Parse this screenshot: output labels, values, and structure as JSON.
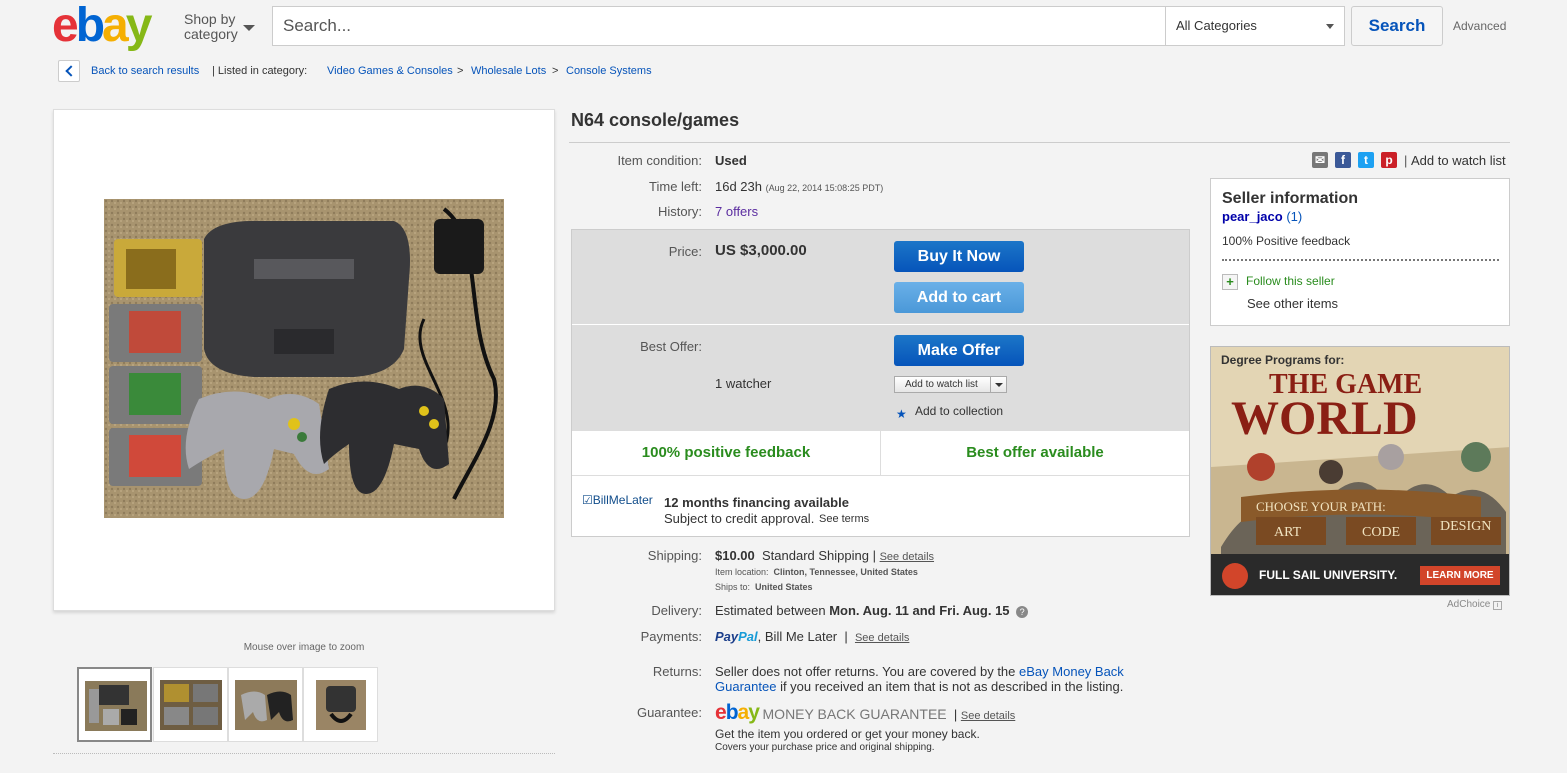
{
  "header": {
    "logo_letters": [
      "e",
      "b",
      "a",
      "y"
    ],
    "shop_by_line1": "Shop by",
    "shop_by_line2": "category",
    "search_placeholder": "Search...",
    "category_selected": "All Categories",
    "search_button": "Search",
    "advanced_link": "Advanced"
  },
  "breadcrumb": {
    "back_link": "Back to search results",
    "listed_in": "| Listed in category:",
    "items": [
      "Video Games & Consoles",
      "Wholesale Lots",
      "Console Systems"
    ],
    "separator": ">"
  },
  "gallery": {
    "zoom_hint": "Mouse over image to zoom",
    "thumbnail_count": 4
  },
  "item": {
    "title": "N64 console/games",
    "condition_label": "Item condition:",
    "condition_value": "Used",
    "time_left_label": "Time left:",
    "time_left_value": "16d 23h",
    "time_left_detail": "(Aug 22, 2014   15:08:25 PDT)",
    "history_label": "History:",
    "history_value": "7 offers"
  },
  "purchase": {
    "price_label": "Price:",
    "price_value": "US $3,000.00",
    "buy_it_now": "Buy It Now",
    "add_to_cart": "Add to cart",
    "best_offer_label": "Best Offer:",
    "make_offer": "Make Offer",
    "watchers": "1 watcher",
    "add_to_watch_select": "Add to watch list",
    "add_to_collection": "Add to collection",
    "feedback_left": "100% positive feedback",
    "feedback_right": "Best offer available",
    "bml_logo": "BillMeLater",
    "bml_title": "12 months financing available",
    "bml_subtitle": "Subject to credit approval.",
    "bml_link": "See terms"
  },
  "shipping": {
    "shipping_label": "Shipping:",
    "shipping_cost": "$10.00",
    "shipping_type": "Standard Shipping",
    "see_details": "See details",
    "location_label": "Item location:",
    "location_value": "Clinton, Tennessee, United States",
    "ships_to_label": "Ships to:",
    "ships_to_value": "United States",
    "delivery_label": "Delivery:",
    "delivery_prefix": "Estimated between",
    "delivery_range": "Mon. Aug. 11 and Fri. Aug. 15",
    "payments_label": "Payments:",
    "paypal_pay": "Pay",
    "paypal_pal": "Pal",
    "payments_other": ", Bill Me Later",
    "returns_label": "Returns:",
    "returns_text": "Seller does not offer returns. You are covered by the",
    "returns_link": "eBay Money Back Guarantee",
    "returns_text2": "if you received an item that is not as described in the listing.",
    "guarantee_label": "Guarantee:",
    "guarantee_logo": "MONEY BACK GUARANTEE",
    "guarantee_line1": "Get the item you ordered or get your money back.",
    "guarantee_line2": "Covers your purchase price and original shipping."
  },
  "share": {
    "icons": [
      "email-icon",
      "facebook-icon",
      "twitter-icon",
      "pinterest-icon"
    ],
    "watch_link": "Add to watch list"
  },
  "seller": {
    "heading": "Seller information",
    "name": "pear_jaco",
    "score": "1",
    "feedback": "100% Positive feedback",
    "follow": "Follow this seller",
    "other_items": "See other items"
  },
  "ad": {
    "line1": "Degree Programs for:",
    "line2": "THE GAME",
    "line3": "WORLD",
    "banner": "CHOOSE YOUR PATH:",
    "paths": [
      "ART",
      "CODE",
      "DESIGN"
    ],
    "school": "FULL SAIL UNIVERSITY.",
    "cta": "LEARN MORE",
    "adchoice": "AdChoice"
  },
  "colors": {
    "link": "#0654ba",
    "green": "#2a8c1e",
    "button_blue": "#0654ba"
  }
}
